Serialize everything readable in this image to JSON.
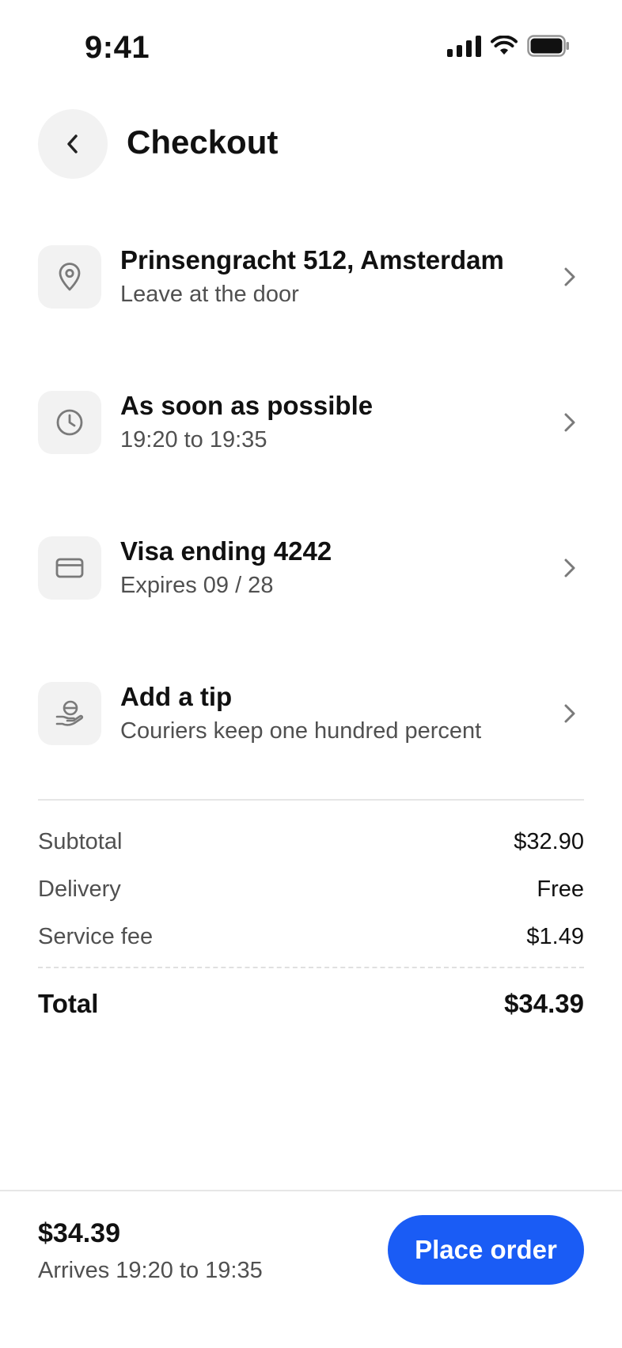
{
  "status_bar": {
    "time": "9:41"
  },
  "header": {
    "title": "Checkout",
    "back_icon": "chevron-left-icon"
  },
  "rows": [
    {
      "icon": "location-pin-icon",
      "title": "Prinsengracht 512, Amsterdam",
      "subtitle": "Leave at the door"
    },
    {
      "icon": "clock-icon",
      "title": "As soon as possible",
      "subtitle": "19:20 to 19:35"
    },
    {
      "icon": "credit-card-icon",
      "title": "Visa ending 4242",
      "subtitle": "Expires 09 / 28"
    },
    {
      "icon": "tip-hand-icon",
      "title": "Add a tip",
      "subtitle": "Couriers keep one hundred percent"
    }
  ],
  "summary": {
    "lines": [
      {
        "label": "Subtotal",
        "value": "$32.90"
      },
      {
        "label": "Delivery",
        "value": "Free"
      },
      {
        "label": "Service fee",
        "value": "$1.49"
      }
    ],
    "total": {
      "label": "Total",
      "value": "$34.39"
    }
  },
  "footer": {
    "total": "$34.39",
    "eta": "Arrives 19:20 to 19:35",
    "button_label": "Place order"
  },
  "colors": {
    "accent": "#1a5cf5",
    "tile_bg": "#f2f2f2",
    "muted_text": "#505050"
  }
}
